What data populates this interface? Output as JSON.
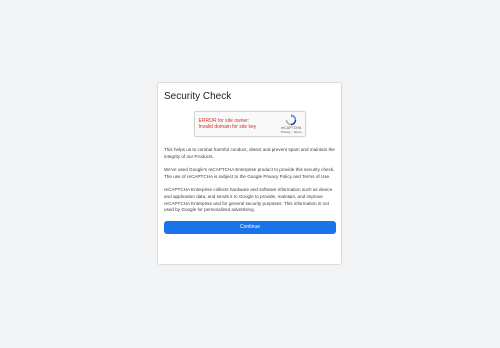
{
  "dialog": {
    "title": "Security Check",
    "recaptcha": {
      "error_line1": "ERROR for site owner:",
      "error_line2": "Invalid domain for site key",
      "brand": "reCAPTCHA",
      "privacy": "Privacy",
      "separator": " - ",
      "terms": "Terms"
    },
    "paragraphs": [
      "This helps us to combat harmful conduct, detect and prevent spam and maintain the integrity of our Products.",
      "We've used Google's reCAPTCHA Enterprise product to provide this security check. The use of reCAPTCHA is subject to the Google Privacy Policy and Terms of Use.",
      "reCAPTCHA Enterprise collects hardware and software information such as device and application data, and sends it to Google to provide, maintain, and improve reCAPTCHA Enterprise and for general security purposes. This information is not used by Google for personalized advertising."
    ],
    "continue_label": "Continue"
  },
  "icons": {
    "recaptcha_logo": "recaptcha-logo-icon"
  },
  "colors": {
    "background": "#f1f3f4",
    "accent": "#1a73e8",
    "error": "#d93025"
  }
}
